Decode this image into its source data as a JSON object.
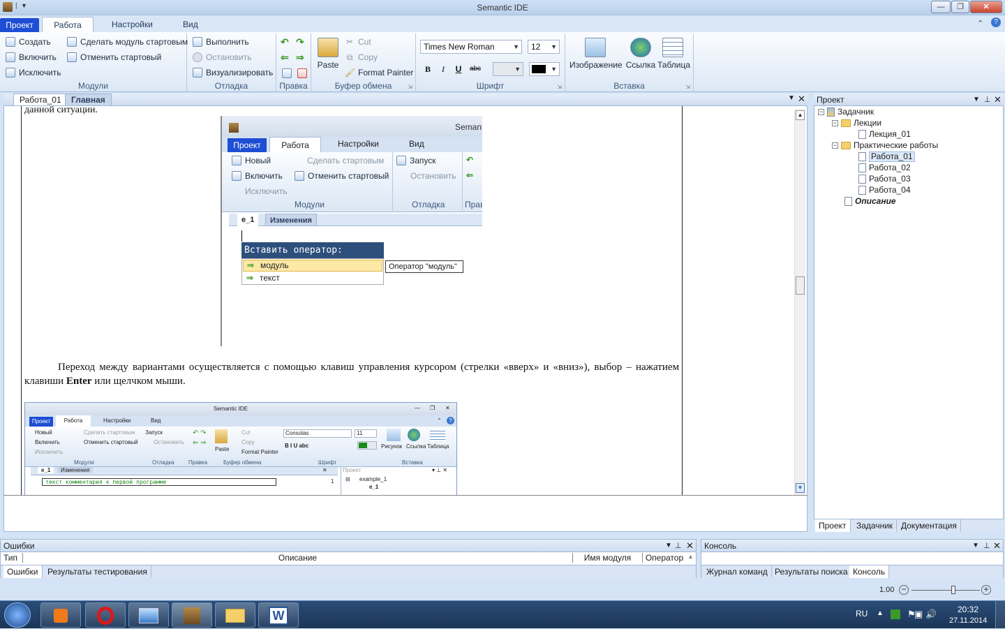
{
  "window": {
    "title": "Semantic IDE",
    "controls": [
      "—",
      "❐",
      "✕"
    ]
  },
  "ribbon": {
    "tabs": [
      "Проект",
      "Работа",
      "Настройки",
      "Вид"
    ],
    "modules": {
      "create": "Создать",
      "include": "Включить",
      "exclude": "Исключить",
      "make_start": "Сделать модуль стартовым",
      "cancel_start": "Отменить стартовый",
      "label": "Модули"
    },
    "debug": {
      "run": "Выполнить",
      "stop": "Остановить",
      "visualize": "Визуализировать",
      "label": "Отладка"
    },
    "edit": {
      "label": "Правка"
    },
    "clipboard": {
      "paste": "Paste",
      "cut": "Cut",
      "copy": "Copy",
      "format_painter": "Format Painter",
      "label": "Буфер обмена"
    },
    "font": {
      "name": "Times New Roman",
      "size": "12",
      "bold": "B",
      "italic": "I",
      "underline": "U",
      "strike": "abc",
      "label": "Шрифт"
    },
    "insert": {
      "image": "Изображение",
      "link": "Ссылка",
      "table": "Таблица",
      "label": "Вставка"
    }
  },
  "doc_tabs": [
    "Работа_01",
    "Главная"
  ],
  "document": {
    "fragment_top": "данной ситуации.",
    "paragraph_pre": "Переход между вариантами осуществляется с помощью клавиш управления курсором (стрелки «вверх» и «вниз»), выбор – нажатием клавиши ",
    "paragraph_bold": "Enter",
    "paragraph_post": " или щелчком мыши.",
    "shot1": {
      "title": "Semanti",
      "tabs": [
        "Проект",
        "Работа",
        "Настройки",
        "Вид"
      ],
      "new": "Новый",
      "include": "Включить",
      "exclude": "Исключить",
      "make_start": "Сделать стартовым",
      "cancel_start": "Отменить стартовый",
      "run": "Запуск",
      "stop": "Остановить",
      "modules": "Модули",
      "debug": "Отладка",
      "edit": "Прав",
      "doctab1": "e_1",
      "doctab2": "Изменения",
      "insert_title": "Вставить оператор:",
      "option1": "модуль",
      "option2": "текст",
      "tooltip": "Оператор \"модуль\""
    },
    "shot2": {
      "title": "Semantic IDE",
      "tabs": [
        "Проект",
        "Работа",
        "Настройки",
        "Вид"
      ],
      "new": "Новый",
      "include": "Включить",
      "exclude": "Исключить",
      "make_start": "Сделать стартовым",
      "cancel_start": "Отменить стартовый",
      "run": "Запуск",
      "stop": "Остановить",
      "paste": "Paste",
      "cut": "Cut",
      "copy": "Copy",
      "format_painter": "Format Painter",
      "font": "Consolas",
      "size": "11",
      "image": "Рисунок",
      "link": "Ссылка",
      "table": "Таблица",
      "groups": [
        "Модули",
        "Отладка",
        "Правка",
        "Буфер обмена",
        "Шрифт",
        "Вставка"
      ],
      "doctab1": "e_1",
      "doctab2": "Изменения",
      "comment": "текст комментария к первой программе",
      "line_no": "1",
      "tree_root": "example_1",
      "tree_child": "e_1",
      "panel": "Проект"
    }
  },
  "project_panel": {
    "title": "Проект",
    "tree": {
      "root": "Задачник",
      "lectures": "Лекции",
      "lecture_01": "Лекция_01",
      "practical": "Практические работы",
      "works": [
        "Работа_01",
        "Работа_02",
        "Работа_03",
        "Работа_04"
      ],
      "description": "Описание"
    },
    "tabs": [
      "Проект",
      "Задачник",
      "Документация"
    ]
  },
  "errors_panel": {
    "title": "Ошибки",
    "columns": [
      "Тип",
      "Описание",
      "Имя модуля",
      "Оператор"
    ],
    "tabs": [
      "Ошибки",
      "Результаты тестирования"
    ]
  },
  "console_panel": {
    "title": "Консоль",
    "tabs": [
      "Журнал команд",
      "Результаты поиска",
      "Консоль"
    ]
  },
  "zoom": {
    "value": "1.00",
    "fraction": 0.62
  },
  "taskbar": {
    "lang": "RU",
    "time": "20:32",
    "date": "27.11.2014"
  },
  "colors": {
    "accent": "#1d4ed3",
    "ribbon": "#dce8f6",
    "taskbar": "#1c3558"
  }
}
